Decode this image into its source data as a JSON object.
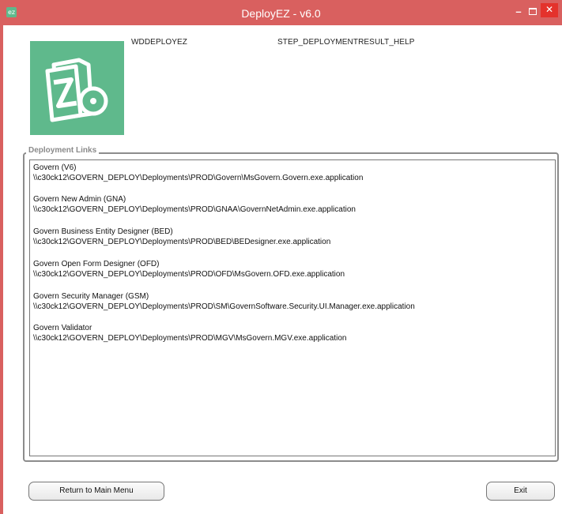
{
  "window": {
    "title": "DeployEZ - v6.0",
    "app_icon_text": "ez",
    "minimize_glyph": "–",
    "close_glyph": "✕",
    "titlebar_color": "#d9605f",
    "close_color": "#e4322c"
  },
  "header": {
    "app_label": "WDDEPLOYEZ",
    "step_label": "STEP_DEPLOYMENTRESULT_HELP",
    "logo_icon": "zip-disc-icon",
    "logo_color": "#5fb98c"
  },
  "deployment_links": {
    "legend": "Deployment Links",
    "items": [
      {
        "name": "Govern (V6)",
        "path": "\\\\c30ck12\\GOVERN_DEPLOY\\Deployments\\PROD\\Govern\\MsGovern.Govern.exe.application"
      },
      {
        "name": "Govern New Admin (GNA)",
        "path": "\\\\c30ck12\\GOVERN_DEPLOY\\Deployments\\PROD\\GNAA\\GovernNetAdmin.exe.application"
      },
      {
        "name": "Govern Business Entity Designer (BED)",
        "path": "\\\\c30ck12\\GOVERN_DEPLOY\\Deployments\\PROD\\BED\\BEDesigner.exe.application"
      },
      {
        "name": "Govern Open Form Designer (OFD)",
        "path": "\\\\c30ck12\\GOVERN_DEPLOY\\Deployments\\PROD\\OFD\\MsGovern.OFD.exe.application"
      },
      {
        "name": "Govern Security Manager (GSM)",
        "path": "\\\\c30ck12\\GOVERN_DEPLOY\\Deployments\\PROD\\SM\\GovernSoftware.Security.UI.Manager.exe.application"
      },
      {
        "name": "Govern Validator",
        "path": "\\\\c30ck12\\GOVERN_DEPLOY\\Deployments\\PROD\\MGV\\MsGovern.MGV.exe.application"
      }
    ]
  },
  "footer": {
    "return_label": "Return to Main Menu",
    "exit_label": "Exit"
  }
}
